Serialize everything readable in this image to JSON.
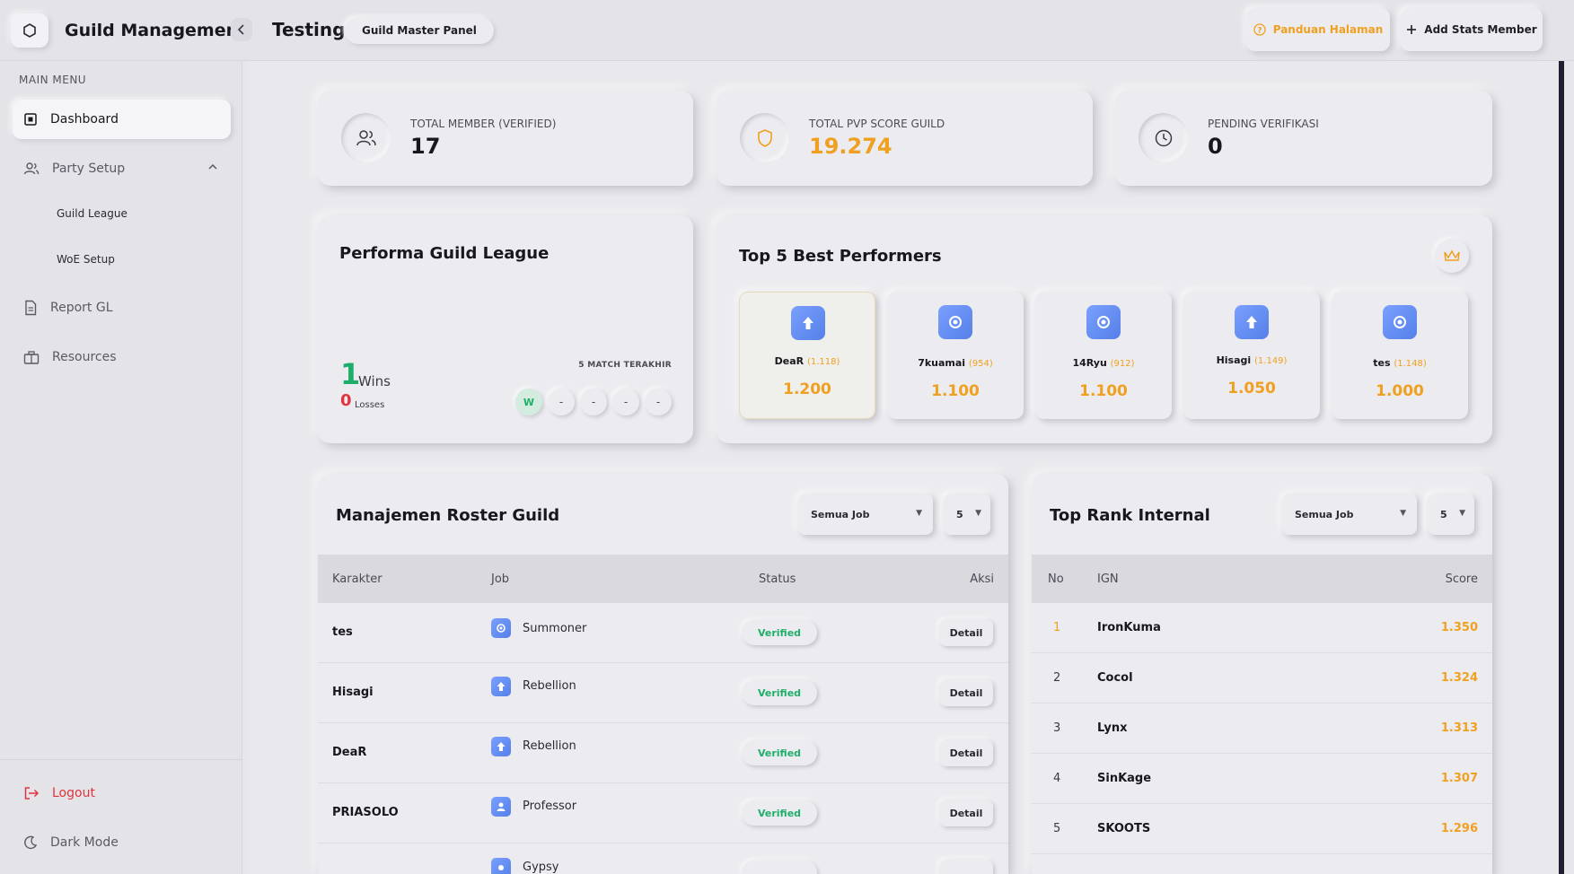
{
  "app": {
    "title": "Guild Management",
    "page_title": "Testing",
    "panel_badge": "Guild Master Panel"
  },
  "header": {
    "guide_label": "Panduan Halaman",
    "add_label": "Add Stats Member",
    "accent_color": "#f0a020"
  },
  "sidebar": {
    "heading": "MAIN MENU",
    "dashboard": "Dashboard",
    "party_setup": "Party Setup",
    "guild_league": "Guild League",
    "woe_setup": "WoE Setup",
    "report_gl": "Report GL",
    "resources": "Resources",
    "logout": "Logout",
    "dark_mode": "Dark Mode"
  },
  "stats": [
    {
      "label": "TOTAL MEMBER (VERIFIED)",
      "value": "17",
      "icon": "users-icon"
    },
    {
      "label": "TOTAL PVP SCORE GUILD",
      "value": "19.274",
      "icon": "shield-icon"
    },
    {
      "label": "PENDING VERIFIKASI",
      "value": "0",
      "icon": "clock-icon"
    }
  ],
  "league": {
    "title": "Performa Guild League",
    "wins": "1",
    "wins_label": "Wins",
    "losses": "0",
    "losses_label": "Losses",
    "matches_label": "5 MATCH TERAKHIR",
    "matches": [
      "W",
      "-",
      "-",
      "-",
      "-"
    ]
  },
  "top_performers": {
    "title": "Top 5 Best Performers",
    "items": [
      {
        "name": "DeaR",
        "sub": "(1.118)",
        "score": "1.200"
      },
      {
        "name": "7kuamai",
        "sub": "(954)",
        "score": "1.100"
      },
      {
        "name": "14Ryu",
        "sub": "(912)",
        "score": "1.100"
      },
      {
        "name": "Hisagi",
        "sub": "(1.149)",
        "score": "1.050"
      },
      {
        "name": "tes",
        "sub": "(1.148)",
        "score": "1.000"
      }
    ]
  },
  "roster": {
    "title": "Manajemen Roster Guild",
    "filter_job": "Semua Job",
    "filter_count": "5",
    "columns": [
      "Karakter",
      "Job",
      "Status",
      "Aksi"
    ],
    "rows": [
      {
        "name": "tes",
        "job": "Summoner",
        "status": "Verified",
        "action": "Detail"
      },
      {
        "name": "Hisagi",
        "job": "Rebellion",
        "status": "Verified",
        "action": "Detail"
      },
      {
        "name": "DeaR",
        "job": "Rebellion",
        "status": "Verified",
        "action": "Detail"
      },
      {
        "name": "PRIASOLO",
        "job": "Professor",
        "status": "Verified",
        "action": "Detail"
      },
      {
        "name": "",
        "job": "Gypsy",
        "status": "",
        "action": ""
      }
    ]
  },
  "rank": {
    "title": "Top Rank Internal",
    "filter_job": "Semua Job",
    "filter_count": "5",
    "columns": [
      "No",
      "IGN",
      "Score"
    ],
    "rows": [
      {
        "no": "1",
        "ign": "IronKuma",
        "score": "1.350"
      },
      {
        "no": "2",
        "ign": "Cocol",
        "score": "1.324"
      },
      {
        "no": "3",
        "ign": "Lynx",
        "score": "1.313"
      },
      {
        "no": "4",
        "ign": "SinKage",
        "score": "1.307"
      },
      {
        "no": "5",
        "ign": "SKOOTS",
        "score": "1.296"
      }
    ]
  }
}
